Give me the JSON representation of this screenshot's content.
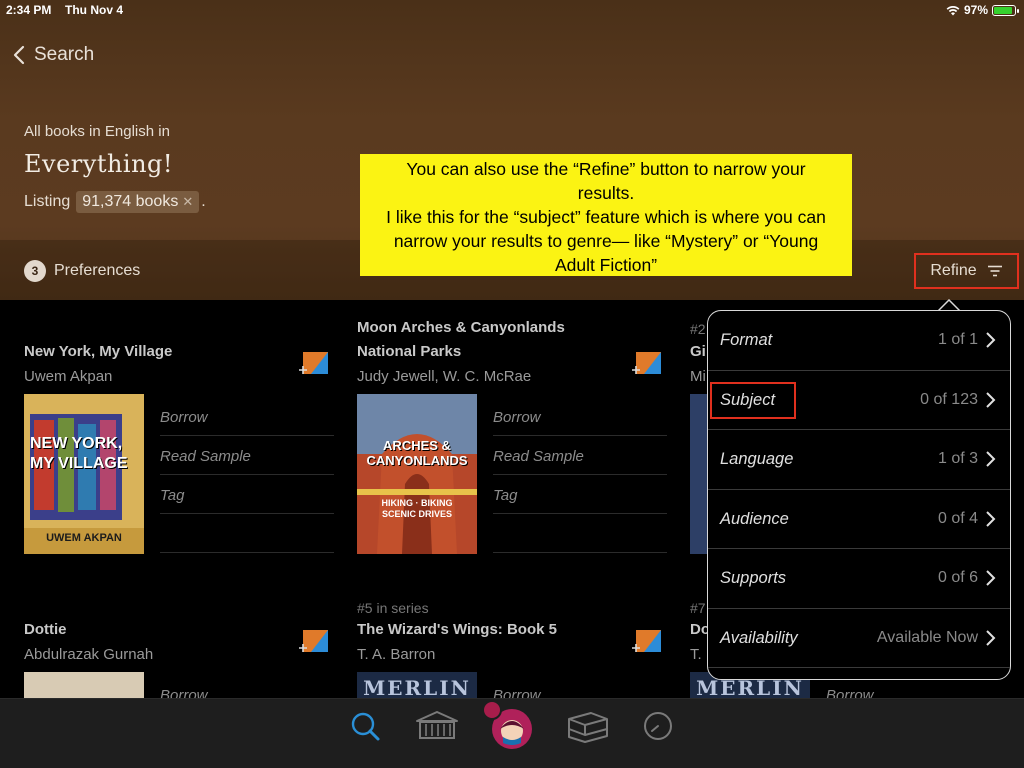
{
  "status_bar": {
    "time": "2:34 PM",
    "date": "Thu Nov 4",
    "battery": "97%"
  },
  "header": {
    "back_label": "Search",
    "context": "All books in English in",
    "collection": "Everything!",
    "listing_prefix": "Listing",
    "listing_count": "91,374 books",
    "listing_suffix": ".",
    "preferences_count": "3",
    "preferences_label": "Preferences",
    "refine_label": "Refine"
  },
  "annotation": {
    "lines": [
      "You can also use the “Refine” button to narrow your",
      "results.",
      "I like this for the “subject” feature which is where you can",
      "narrow your results to genre— like “Mystery” or “Young",
      "Adult Fiction”"
    ]
  },
  "books": [
    {
      "series": "",
      "title_lines": [
        "New York, My Village"
      ],
      "author": "Uwem Akpan",
      "cover_title": "NEW YORK, MY VILLAGE",
      "cover_author": "UWEM AKPAN",
      "actions": [
        "Borrow",
        "Read Sample",
        "Tag"
      ]
    },
    {
      "series": "",
      "title_lines": [
        "Moon Arches & Canyonlands",
        "National Parks"
      ],
      "author": "Judy Jewell, W. C. McRae",
      "cover_title": "ARCHES & CANYONLANDS",
      "cover_author": "HIKING · BIKING SCENIC DRIVES",
      "actions": [
        "Borrow",
        "Read Sample",
        "Tag"
      ]
    },
    {
      "series": "#2",
      "title_lines": [
        "Gi"
      ],
      "author": "Mi",
      "actions": []
    },
    {
      "series": "",
      "title_lines": [
        "Dottie"
      ],
      "author": "Abdulrazak Gurnah",
      "actions": [
        "Borrow"
      ]
    },
    {
      "series": "#5 in series",
      "title_lines": [
        "The Wizard's Wings: Book 5"
      ],
      "author": "T. A. Barron",
      "cover_title": "MERLIN",
      "actions": [
        "Borrow"
      ]
    },
    {
      "series": "#7",
      "title_lines": [
        "Do"
      ],
      "author": "T.",
      "cover_title": "MERLIN",
      "actions": [
        "Borrow"
      ]
    }
  ],
  "refine_menu": {
    "rows": [
      {
        "label": "Format",
        "value": "1 of 1"
      },
      {
        "label": "Subject",
        "value": "0 of 123"
      },
      {
        "label": "Language",
        "value": "1 of 3"
      },
      {
        "label": "Audience",
        "value": "0 of 4"
      },
      {
        "label": "Supports",
        "value": "0 of 6"
      },
      {
        "label": "Availability",
        "value": "Available Now"
      }
    ]
  },
  "colors": {
    "header_brown": "#5a3a1f",
    "highlight_red": "#e0301e",
    "note_yellow": "#fbf313",
    "tab_active_blue": "#2a8fd6"
  },
  "tabbar": {
    "icons": [
      "search-icon",
      "library-icon",
      "home-libby-icon",
      "shelf-icon",
      "timeline-icon"
    ]
  }
}
